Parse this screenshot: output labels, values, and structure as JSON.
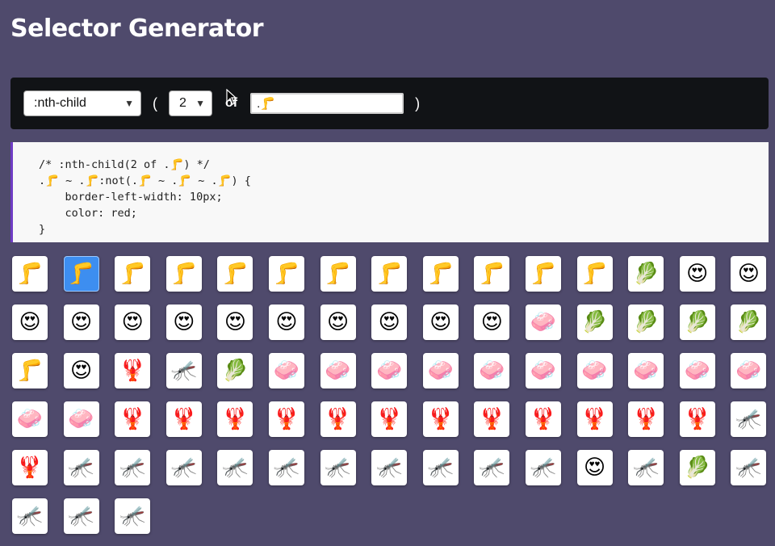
{
  "title": "Selector Generator",
  "controls": {
    "pseudo_select": ":nth-child",
    "open_paren": "(",
    "number_select": "2",
    "of_label": "of",
    "selector_input": ".🦵",
    "close_paren": ")"
  },
  "code": {
    "line1": "/* :nth-child(2 of .🦵) */",
    "line2": ".🦵 ~ .🦵:not(.🦵 ~ .🦵 ~ .🦵) {",
    "line3": "    border-left-width: 10px;",
    "line4": "    color: red;",
    "line5": "}"
  },
  "colors": {
    "background": "#4f4a6c",
    "control_bar": "#111316",
    "code_border": "#6f3cc4",
    "selected_tile": "#3d8ef0"
  },
  "tiles": [
    {
      "emoji": "🦵",
      "name": "leg-icon",
      "selected": false
    },
    {
      "emoji": "🦵",
      "name": "leg-icon",
      "selected": true
    },
    {
      "emoji": "🦵",
      "name": "leg-icon",
      "selected": false
    },
    {
      "emoji": "🦵",
      "name": "leg-icon",
      "selected": false
    },
    {
      "emoji": "🦵",
      "name": "leg-icon",
      "selected": false
    },
    {
      "emoji": "🦵",
      "name": "leg-icon",
      "selected": false
    },
    {
      "emoji": "🦵",
      "name": "leg-icon",
      "selected": false
    },
    {
      "emoji": "🦵",
      "name": "leg-icon",
      "selected": false
    },
    {
      "emoji": "🦵",
      "name": "leg-icon",
      "selected": false
    },
    {
      "emoji": "🦵",
      "name": "leg-icon",
      "selected": false
    },
    {
      "emoji": "🦵",
      "name": "leg-icon",
      "selected": false
    },
    {
      "emoji": "🦵",
      "name": "leg-icon",
      "selected": false
    },
    {
      "emoji": "🥬",
      "name": "leafy-green-icon",
      "selected": false
    },
    {
      "emoji": "😍",
      "name": "heart-eyes-icon",
      "selected": false
    },
    {
      "emoji": "😍",
      "name": "heart-eyes-icon",
      "selected": false
    },
    {
      "emoji": "😍",
      "name": "heart-eyes-icon",
      "selected": false
    },
    {
      "emoji": "😍",
      "name": "heart-eyes-icon",
      "selected": false
    },
    {
      "emoji": "😍",
      "name": "heart-eyes-icon",
      "selected": false
    },
    {
      "emoji": "😍",
      "name": "heart-eyes-icon",
      "selected": false
    },
    {
      "emoji": "😍",
      "name": "heart-eyes-icon",
      "selected": false
    },
    {
      "emoji": "😍",
      "name": "heart-eyes-icon",
      "selected": false
    },
    {
      "emoji": "😍",
      "name": "heart-eyes-icon",
      "selected": false
    },
    {
      "emoji": "😍",
      "name": "heart-eyes-icon",
      "selected": false
    },
    {
      "emoji": "😍",
      "name": "heart-eyes-icon",
      "selected": false
    },
    {
      "emoji": "😍",
      "name": "heart-eyes-icon",
      "selected": false
    },
    {
      "emoji": "🧼",
      "name": "soap-icon",
      "selected": false
    },
    {
      "emoji": "🥬",
      "name": "leafy-green-icon",
      "selected": false
    },
    {
      "emoji": "🥬",
      "name": "leafy-green-icon",
      "selected": false
    },
    {
      "emoji": "🥬",
      "name": "leafy-green-icon",
      "selected": false
    },
    {
      "emoji": "🥬",
      "name": "leafy-green-icon",
      "selected": false
    },
    {
      "emoji": "🦵",
      "name": "leg-icon",
      "selected": false
    },
    {
      "emoji": "😍",
      "name": "heart-eyes-icon",
      "selected": false
    },
    {
      "emoji": "🦞",
      "name": "lobster-icon",
      "selected": false
    },
    {
      "emoji": "🦟",
      "name": "mosquito-icon",
      "selected": false
    },
    {
      "emoji": "🥬",
      "name": "leafy-green-icon",
      "selected": false
    },
    {
      "emoji": "🧼",
      "name": "soap-icon",
      "selected": false
    },
    {
      "emoji": "🧼",
      "name": "soap-icon",
      "selected": false
    },
    {
      "emoji": "🧼",
      "name": "soap-icon",
      "selected": false
    },
    {
      "emoji": "🧼",
      "name": "soap-icon",
      "selected": false
    },
    {
      "emoji": "🧼",
      "name": "soap-icon",
      "selected": false
    },
    {
      "emoji": "🧼",
      "name": "soap-icon",
      "selected": false
    },
    {
      "emoji": "🧼",
      "name": "soap-icon",
      "selected": false
    },
    {
      "emoji": "🧼",
      "name": "soap-icon",
      "selected": false
    },
    {
      "emoji": "🧼",
      "name": "soap-icon",
      "selected": false
    },
    {
      "emoji": "🧼",
      "name": "soap-icon",
      "selected": false
    },
    {
      "emoji": "🧼",
      "name": "soap-icon",
      "selected": false
    },
    {
      "emoji": "🧼",
      "name": "soap-icon",
      "selected": false
    },
    {
      "emoji": "🦞",
      "name": "lobster-icon",
      "selected": false
    },
    {
      "emoji": "🦞",
      "name": "lobster-icon",
      "selected": false
    },
    {
      "emoji": "🦞",
      "name": "lobster-icon",
      "selected": false
    },
    {
      "emoji": "🦞",
      "name": "lobster-icon",
      "selected": false
    },
    {
      "emoji": "🦞",
      "name": "lobster-icon",
      "selected": false
    },
    {
      "emoji": "🦞",
      "name": "lobster-icon",
      "selected": false
    },
    {
      "emoji": "🦞",
      "name": "lobster-icon",
      "selected": false
    },
    {
      "emoji": "🦞",
      "name": "lobster-icon",
      "selected": false
    },
    {
      "emoji": "🦞",
      "name": "lobster-icon",
      "selected": false
    },
    {
      "emoji": "🦞",
      "name": "lobster-icon",
      "selected": false
    },
    {
      "emoji": "🦞",
      "name": "lobster-icon",
      "selected": false
    },
    {
      "emoji": "🦞",
      "name": "lobster-icon",
      "selected": false
    },
    {
      "emoji": "🦟",
      "name": "mosquito-icon",
      "selected": false
    },
    {
      "emoji": "🦞",
      "name": "lobster-icon",
      "selected": false
    },
    {
      "emoji": "🦟",
      "name": "mosquito-icon",
      "selected": false
    },
    {
      "emoji": "🦟",
      "name": "mosquito-icon",
      "selected": false
    },
    {
      "emoji": "🦟",
      "name": "mosquito-icon",
      "selected": false
    },
    {
      "emoji": "🦟",
      "name": "mosquito-icon",
      "selected": false
    },
    {
      "emoji": "🦟",
      "name": "mosquito-icon",
      "selected": false
    },
    {
      "emoji": "🦟",
      "name": "mosquito-icon",
      "selected": false
    },
    {
      "emoji": "🦟",
      "name": "mosquito-icon",
      "selected": false
    },
    {
      "emoji": "🦟",
      "name": "mosquito-icon",
      "selected": false
    },
    {
      "emoji": "🦟",
      "name": "mosquito-icon",
      "selected": false
    },
    {
      "emoji": "🦟",
      "name": "mosquito-icon",
      "selected": false
    },
    {
      "emoji": "😍",
      "name": "heart-eyes-icon",
      "selected": false
    },
    {
      "emoji": "🦟",
      "name": "mosquito-icon",
      "selected": false
    },
    {
      "emoji": "🥬",
      "name": "leafy-green-icon",
      "selected": false
    },
    {
      "emoji": "🦟",
      "name": "mosquito-icon",
      "selected": false
    },
    {
      "emoji": "🦟",
      "name": "mosquito-icon",
      "selected": false
    },
    {
      "emoji": "🦟",
      "name": "mosquito-icon",
      "selected": false
    },
    {
      "emoji": "🦟",
      "name": "mosquito-icon",
      "selected": false
    }
  ]
}
